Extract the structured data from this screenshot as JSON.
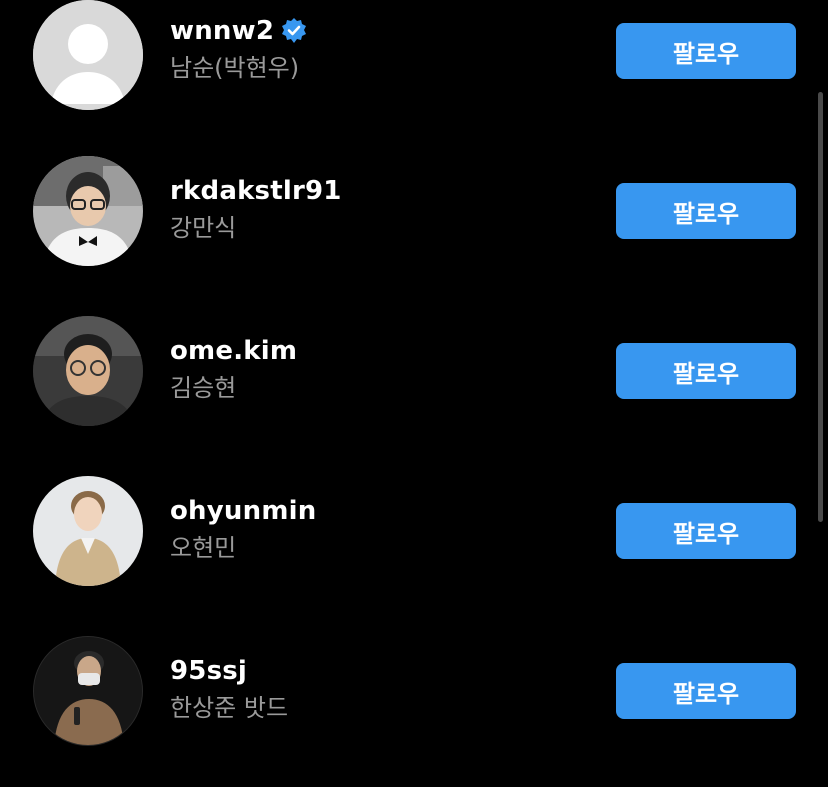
{
  "follow_list": {
    "button_label": "팔로우",
    "accent_color": "#3897f0",
    "users": [
      {
        "username": "wnnw2",
        "full_name": "남순(박현우)",
        "verified": true,
        "avatar": "default-person-avatar"
      },
      {
        "username": "rkdakstlr91",
        "full_name": "강만식",
        "verified": false,
        "avatar": "photo-man-glasses-bowtie"
      },
      {
        "username": "ome.kim",
        "full_name": "김승현",
        "verified": false,
        "avatar": "photo-man-glasses"
      },
      {
        "username": "ohyunmin",
        "full_name": "오현민",
        "verified": false,
        "avatar": "photo-man-trenchcoat"
      },
      {
        "username": "95ssj",
        "full_name": "한상준 밧드",
        "verified": false,
        "avatar": "photo-man-mask-microphone"
      }
    ]
  }
}
